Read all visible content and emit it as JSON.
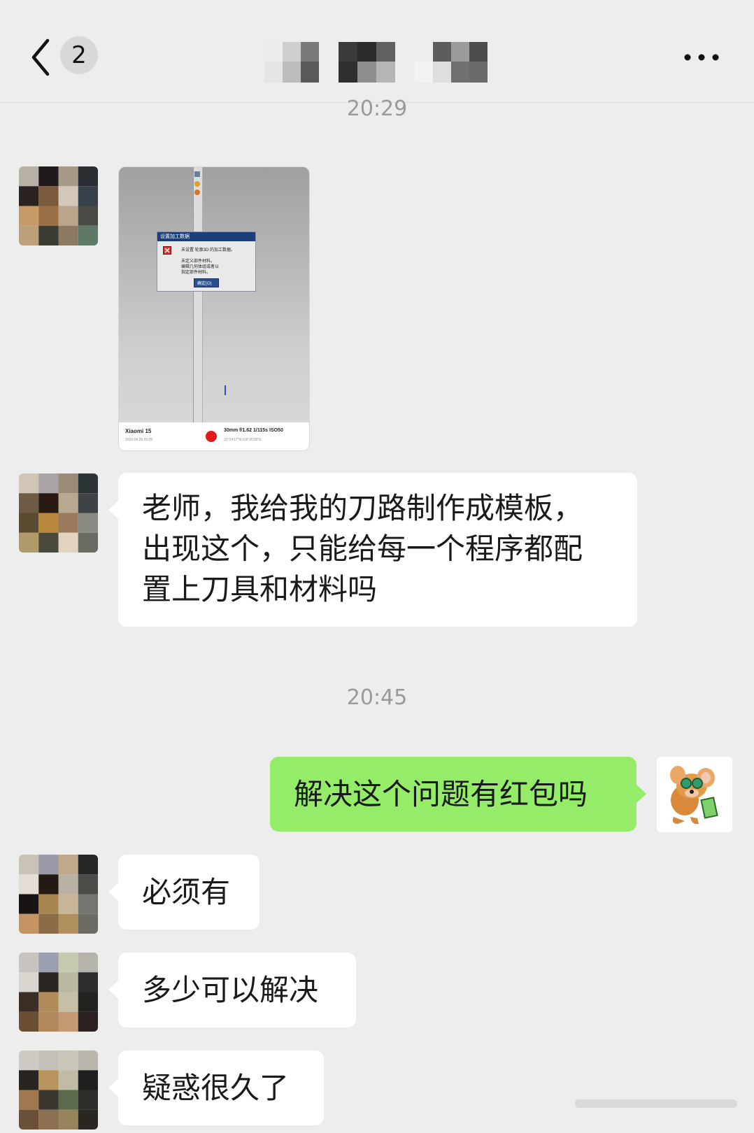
{
  "header": {
    "unread_count": "2",
    "back_icon": "chevron-left-icon",
    "more_icon": "ellipsis-icon"
  },
  "messages": {
    "time1": "20:29",
    "photo": {
      "dialog_title": "设置加工数据",
      "dialog_line1": "未设置 轮廓3D 的加工数据。",
      "dialog_line2": "未定义部件材料。",
      "dialog_line3": "编辑几何体组或者以",
      "dialog_line4": "指定部件材料。",
      "dialog_button": "确定(O)",
      "camera_brand": "Xiaomi 15",
      "camera_date": "2026.04.29 20:29",
      "camera_specs": "30mm  f/1.62  1/115s  ISO50",
      "camera_coords": "31°24'17\"N  116°20'30\"E"
    },
    "msg1": "老师，我给我的刀路制作成模板，\n出现这个，只能给每一个程序都配\n置上刀具和材料吗",
    "time2": "20:45",
    "msg2": "解决这个问题有红包吗",
    "msg3": "必须有",
    "msg4": "多少可以解决",
    "msg5": "疑惑很久了"
  },
  "colors": {
    "background": "#ededed",
    "bubble_in": "#ffffff",
    "bubble_out": "#95ec69",
    "time_text": "#9a9a9a"
  }
}
